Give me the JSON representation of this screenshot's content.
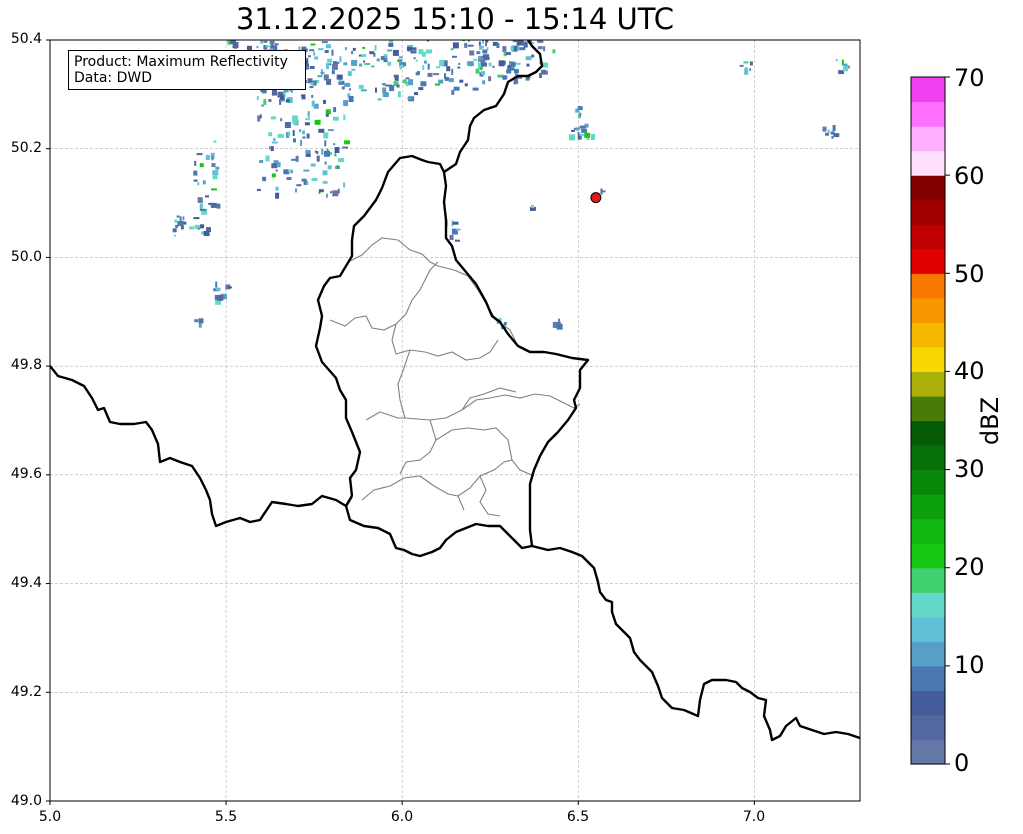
{
  "title": "31.12.2025 15:10 - 15:14 UTC",
  "info_box": {
    "product_line": "Product: Maximum Reflectivity",
    "data_line": "Data: DWD"
  },
  "map": {
    "lon_range": [
      5.0,
      7.3
    ],
    "lat_range": [
      49.0,
      50.4
    ],
    "x_ticks": [
      "5.0",
      "5.5",
      "6.0",
      "6.5",
      "7.0"
    ],
    "y_ticks": [
      "50.4",
      "50.2",
      "50.0",
      "49.8",
      "49.6",
      "49.4",
      "49.2",
      "49.0"
    ],
    "grid": true,
    "marker": {
      "lon": 6.55,
      "lat": 50.11,
      "color": "#e31a1c"
    }
  },
  "colorbar": {
    "label": "dBZ",
    "ticks": [
      "0",
      "10",
      "20",
      "30",
      "40",
      "50",
      "60",
      "70"
    ],
    "range": [
      0,
      70
    ],
    "colors": [
      "#6478a8",
      "#5468a0",
      "#445c9c",
      "#4a78b0",
      "#56a0c8",
      "#60c0d8",
      "#64d8c8",
      "#40d070",
      "#14c814",
      "#10b810",
      "#0ca00c",
      "#088808",
      "#087008",
      "#065c06",
      "#4a7a08",
      "#aab008",
      "#f8d800",
      "#f8b800",
      "#f89800",
      "#f87800",
      "#e00000",
      "#c00000",
      "#a00000",
      "#800000",
      "#ffe0ff",
      "#ffb0ff",
      "#ff70ff",
      "#f040f0"
    ]
  }
}
